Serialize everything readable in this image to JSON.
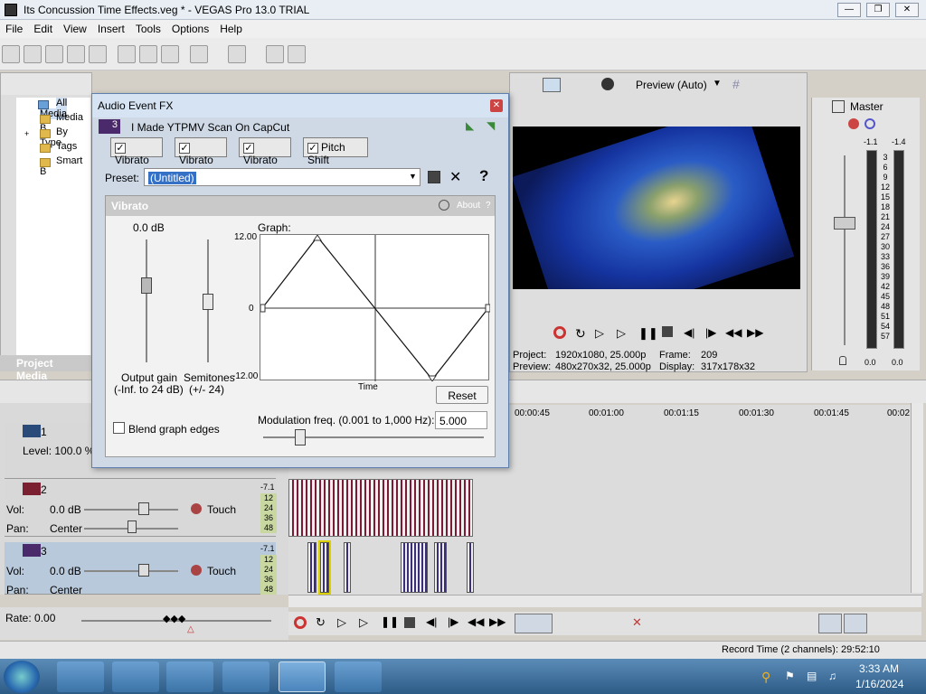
{
  "window": {
    "title": "Its Concussion Time Effects.veg * - VEGAS Pro 13.0 TRIAL"
  },
  "menu": [
    "File",
    "Edit",
    "View",
    "Insert",
    "Tools",
    "Options",
    "Help"
  ],
  "explorer": {
    "tree": [
      "All Media",
      "Media B",
      "By Type",
      "Tags",
      "Smart B"
    ],
    "tab": "Project Media"
  },
  "preview": {
    "mode": "Preview (Auto)",
    "project_label": "Project:",
    "project_value": "1920x1080, 25.000p",
    "preview_label": "Preview:",
    "preview_value": "480x270x32, 25.000p",
    "frame_label": "Frame:",
    "frame_value": "209",
    "display_label": "Display:",
    "display_value": "317x178x32"
  },
  "mixer": {
    "title": "Master",
    "left_peak": "-1.1",
    "right_peak": "-1.4",
    "scale": [
      "3",
      "6",
      "9",
      "12",
      "15",
      "18",
      "21",
      "24",
      "27",
      "30",
      "33",
      "36",
      "39",
      "42",
      "45",
      "48",
      "51",
      "54",
      "57"
    ],
    "left_val": "0.0",
    "right_val": "0.0"
  },
  "dialog": {
    "title": "Audio Event FX",
    "chain_num": "3",
    "chain_name": "I Made YTPMV Scan On CapCut",
    "tabs": [
      "Vibrato",
      "Vibrato",
      "Vibrato",
      "Pitch Shift"
    ],
    "preset_label": "Preset:",
    "preset_value": "(Untitled)",
    "help_glyph": "?",
    "plugin_title": "Vibrato",
    "about": "About",
    "about_q": "?",
    "gain_value": "0.0 dB",
    "graph_label": "Graph:",
    "y_top": "12.00",
    "y_mid": "0",
    "y_bot": "-12.00",
    "x_label": "Time",
    "output_gain_l1": "Output gain",
    "output_gain_l2": "(-Inf. to 24 dB)",
    "semitones_l1": "Semitones",
    "semitones_l2": "(+/- 24)",
    "reset": "Reset",
    "blend": "Blend graph edges",
    "mod_label": "Modulation freq. (0.001 to 1,000 Hz):",
    "mod_value": "5.000",
    "mod_slider_level": 0.17
  },
  "timeline": {
    "ruler": [
      "00:00:45",
      "00:01:00",
      "00:01:15",
      "00:01:30",
      "00:01:45",
      "00:02"
    ]
  },
  "tracks": [
    {
      "num": "1",
      "level": "Level: 100.0 %"
    },
    {
      "num": "2",
      "vol_label": "Vol:",
      "vol": "0.0 dB",
      "pan_label": "Pan:",
      "pan": "Center",
      "mode": "Touch",
      "db": "-7.1"
    },
    {
      "num": "3",
      "vol_label": "Vol:",
      "vol": "0.0 dB",
      "pan_label": "Pan:",
      "pan": "Center",
      "mode": "Touch",
      "db": "-7.1"
    }
  ],
  "meter_scale": [
    "12",
    "24",
    "36",
    "48"
  ],
  "rate": "Rate: 0.00",
  "status": "Record Time (2 channels): 29:52:10",
  "clock": {
    "time": "3:33 AM",
    "date": "1/16/2024"
  }
}
